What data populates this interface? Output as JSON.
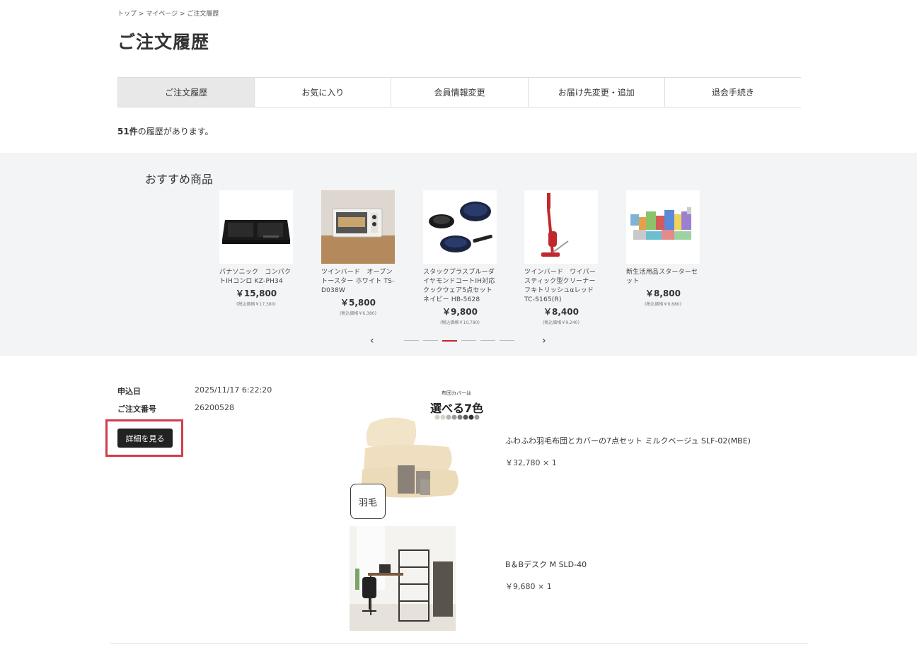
{
  "breadcrumb": "トップ > マイページ > ご注文履歴",
  "page_title": "ご注文履歴",
  "tabs": [
    {
      "label": "ご注文履歴"
    },
    {
      "label": "お気に入り"
    },
    {
      "label": "会員情報変更"
    },
    {
      "label": "お届け先変更・追加"
    },
    {
      "label": "退会手続き"
    }
  ],
  "history_count": {
    "number": "51件",
    "suffix": "の履歴があります。"
  },
  "recommended": {
    "title": "おすすめ商品",
    "items": [
      {
        "name": "パナソニック　コンパクトIHコンロ KZ-PH34",
        "price": "￥15,800",
        "tax": "(税込価格￥17,380)"
      },
      {
        "name": "ツインバード　オーブントースター ホワイト TS-D038W",
        "price": "￥5,800",
        "tax": "(税込価格￥6,380)"
      },
      {
        "name": "スタックプラスブルーダイヤモンドコートIH対応クックウェア5点セット ネイビー HB-5628",
        "price": "￥9,800",
        "tax": "(税込価格￥10,780)"
      },
      {
        "name": "ツインバード　ワイパースティック型クリーナー　フキトリッシュαレッド TC-S165(R)",
        "price": "￥8,400",
        "tax": "(税込価格￥9,240)"
      },
      {
        "name": "新生活用品スターターセット",
        "price": "￥8,800",
        "tax": "(税込価格￥9,680)"
      }
    ],
    "prev_icon": "chevron-left-icon",
    "next_icon": "chevron-right-icon",
    "pages": 6,
    "active_page": 3
  },
  "order": {
    "date_label": "申込日",
    "date_value": "2025/11/17 6:22:20",
    "number_label": "ご注文番号",
    "number_value": "26200528",
    "detail_button": "詳細を見る",
    "highlight_color": "#d23c4a",
    "products": [
      {
        "name": "ふわふわ羽毛布団とカバーの7点セット ミルクベージュ SLF-02(MBE)",
        "price": "￥32,780 × 1",
        "img_caption_small": "布団カバーは",
        "img_caption_large": "選べる7色",
        "img_badge": "羽毛"
      },
      {
        "name": "B＆Bデスク M SLD-40",
        "price": "￥9,680 × 1"
      }
    ]
  }
}
